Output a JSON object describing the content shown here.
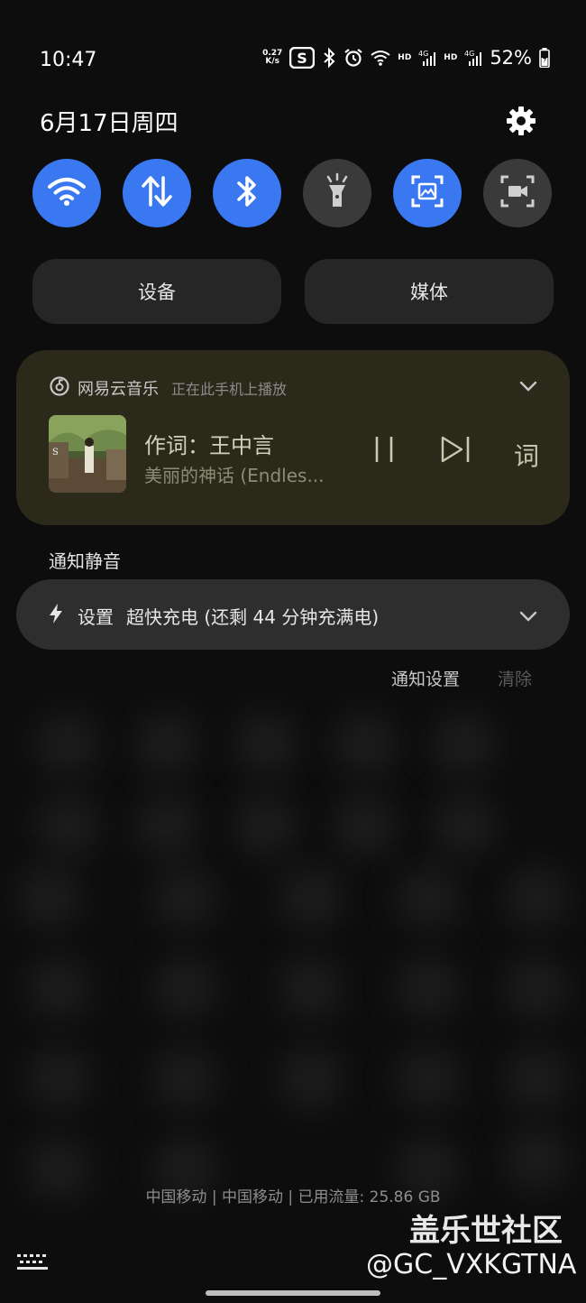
{
  "status_bar": {
    "time": "10:47",
    "net_speed_top": "0.27",
    "net_speed_bottom": "K/s",
    "hd1": "HD",
    "hd2": "HD",
    "battery": "52%"
  },
  "date": "6月17日周四",
  "quick_tiles": [
    {
      "name": "wifi",
      "on": true
    },
    {
      "name": "mobile-data",
      "on": true
    },
    {
      "name": "bluetooth",
      "on": true
    },
    {
      "name": "flashlight",
      "on": false
    },
    {
      "name": "screenshot",
      "on": true
    },
    {
      "name": "screen-recorder",
      "on": false
    }
  ],
  "pills": {
    "devices": "设备",
    "media": "媒体"
  },
  "media": {
    "app_name": "网易云音乐",
    "app_sub": "正在此手机上播放",
    "track_title": "作词：王中言",
    "track_sub": "美丽的神话 (Endles...",
    "lyric_label": "词"
  },
  "section_label": "通知静音",
  "notification": {
    "app": "设置",
    "text": "超快充电 (还剩 44 分钟充满电)"
  },
  "notif_actions": {
    "settings": "通知设置",
    "clear": "清除"
  },
  "carrier": "中国移动 | 中国移动 | 已用流量: 25.86 GB",
  "watermark": "盖乐世社区",
  "handle": "@GC_VXKGTNA",
  "colors": {
    "accent": "#3a78f2",
    "tile_off": "#3a3a3a",
    "media_card": "#2b2a1a"
  }
}
